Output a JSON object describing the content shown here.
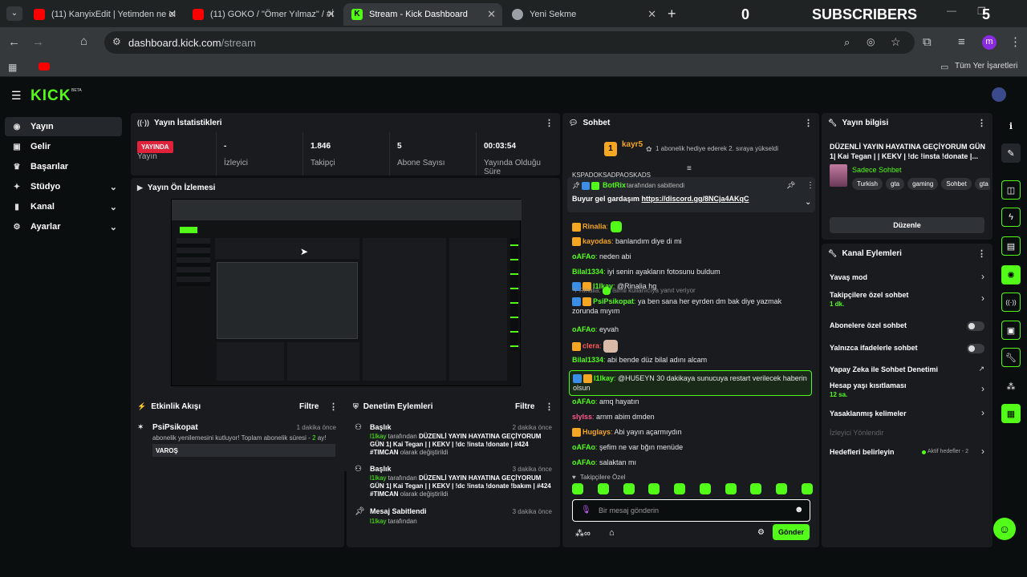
{
  "browser": {
    "tabs": [
      {
        "label": "(11) KanyixEdit | Yetimden ne ol",
        "icon": "youtube-icon",
        "color": "#ff0000"
      },
      {
        "label": "(11) GOKO / \"Ömer Yılmaz\" / #İ",
        "icon": "youtube-icon",
        "color": "#ff0000"
      },
      {
        "label": "Stream - Kick Dashboard",
        "icon": "kick-icon",
        "color": "#53fc18"
      },
      {
        "label": "Yeni Sekme",
        "icon": "chrome-icon",
        "color": "#9aa0a6"
      }
    ],
    "new_tab": "+",
    "overlay": {
      "count": "0",
      "label": "SUBSCRIBERS",
      "goal": "5"
    },
    "url": {
      "domain": "dashboard.kick.com",
      "path": "/stream"
    },
    "profile_initial": "m",
    "bookmarks_label": "Tüm Yer İşaretleri"
  },
  "app": {
    "logo": "KICK",
    "logo_beta": "BETA",
    "sidebar": [
      {
        "label": "Yayın",
        "icon": "broadcast-icon",
        "active": true
      },
      {
        "label": "Gelir",
        "icon": "wallet-icon"
      },
      {
        "label": "Başarılar",
        "icon": "trophy-icon"
      },
      {
        "label": "Stüdyo",
        "icon": "studio-icon",
        "chevron": true
      },
      {
        "label": "Kanal",
        "icon": "channel-icon",
        "chevron": true
      },
      {
        "label": "Ayarlar",
        "icon": "gear-icon",
        "chevron": true
      }
    ],
    "stats": {
      "title": "Yayın İstatistikleri",
      "live_badge": "YAYINDA",
      "items": [
        {
          "value": "",
          "label": "Yayın"
        },
        {
          "value": "-",
          "label": "İzleyici"
        },
        {
          "value": "1.846",
          "label": "Takipçi"
        },
        {
          "value": "5",
          "label": "Abone Sayısı"
        },
        {
          "value": "00:03:54",
          "label": "Yayında Olduğu Süre"
        }
      ]
    },
    "preview": {
      "title": "Yayın Ön İzlemesi"
    },
    "activity": {
      "title": "Etkinlik Akışı",
      "filter": "Filtre",
      "event": {
        "user": "PsiPsikopat",
        "time": "1 dakika önce",
        "text_pre": "abonelik yenilemesini kutluyor! Toplam abonelik süresi - ",
        "months": "2",
        "text_post": " ay!",
        "message": "VAROŞ"
      }
    },
    "moderation": {
      "title": "Denetim Eylemleri",
      "filter": "Filtre",
      "items": [
        {
          "title": "Başlık",
          "time": "2 dakika önce",
          "actor": "l1lkay",
          "by": " tarafından ",
          "content": "DÜZENLİ YAYIN HAYATINA GEÇİYORUM GÜN 1| Kai Tegan | | KEKV | !dc !insta !donate | #424 #TIMCAN",
          "suffix": " olarak değiştirildi"
        },
        {
          "title": "Başlık",
          "time": "3 dakika önce",
          "actor": "l1lkay",
          "by": " tarafından ",
          "content": "DÜZENLİ YAYIN HAYATINA GEÇİYORUM GÜN 1| Kai Tegan | | KEKV | !dc !insta !donate !bakım | #424 #TIMCAN",
          "suffix": " olarak değiştirildi"
        },
        {
          "title": "Mesaj Sabitlendi",
          "time": "3 dakika önce",
          "actor": "l1lkay",
          "by": " tarafından",
          "content": "",
          "suffix": ""
        }
      ]
    },
    "chat": {
      "title": "Sohbet",
      "gift_user": "kayr5",
      "gift_rank": "1",
      "gift_text": "1 abonelik hediye ederek 2. sıraya yükseldi",
      "pinned": {
        "user": "BotRix",
        "by": "tarafından sabitlendi",
        "text": "Buyur gel gardaşım ",
        "link": "https://discord.gg/8NCja4AKqC",
        "peek": "KSPADOKSADPAOSKADS"
      },
      "messages": [
        {
          "user": "Rinalia",
          "color": "#f5a623",
          "text": "",
          "emote": true
        },
        {
          "user": "kayodas",
          "color": "#f5a623",
          "text": "banlandım diye di mi"
        },
        {
          "user": "oAFAo",
          "color": "#53fc18",
          "text": "neden abi"
        },
        {
          "user": "Bilal1334",
          "color": "#53fc18",
          "text": "iyi senin ayakların fotosunu buldum"
        },
        {
          "user": "l1lkay",
          "color": "#53fc18",
          "text": "@Rinalia hg"
        },
        {
          "user": "PsiPsikopat",
          "color": "#53fc18",
          "text": "ya ben sana her eyrden dm bak diye yazmak zorunda mıyım",
          "reply": "Rinalia:",
          "reply_text": "isimli kullanıcıya yanıt veriyor"
        },
        {
          "user": "oAFAo",
          "color": "#53fc18",
          "text": "eyvah"
        },
        {
          "user": "clera",
          "color": "#ff5a5a",
          "text": "",
          "emote": true
        },
        {
          "user": "Bilal1334",
          "color": "#53fc18",
          "text": "abi bende düz bilal adını alcam"
        },
        {
          "user": "l1lkay",
          "color": "#53fc18",
          "text": "@HU5EYN 30 dakikaya sunucuya restart verilecek haberin olsun",
          "highlight": true
        },
        {
          "user": "oAFAo",
          "color": "#53fc18",
          "text": "amq hayatın"
        },
        {
          "user": "slylss",
          "color": "#ff5a8a",
          "text": "arnm abim dmden"
        },
        {
          "user": "Huglays",
          "color": "#f5a623",
          "text": "Abi yayın açarmıydın"
        },
        {
          "user": "oAFAo",
          "color": "#53fc18",
          "text": "şefim ne var bğın menüde"
        },
        {
          "user": "oAFAo",
          "color": "#53fc18",
          "text": "salaktan mı"
        }
      ],
      "followers_label": "Takipçilere Özel",
      "input_placeholder": "Bir mesaj gönderin",
      "send": "Gönder"
    },
    "stream_info": {
      "title": "Yayın bilgisi",
      "stream_title": "DÜZENLİ YAYIN HAYATINA GEÇİYORUM GÜN 1| Kai Tegan | | KEKV | !dc !insta !donate |...",
      "category": "Sadece Sohbet",
      "tags": [
        "Turkish",
        "gta",
        "gaming",
        "Sohbet",
        "gta"
      ],
      "edit": "Düzenle"
    },
    "channel_actions": {
      "title": "Kanal Eylemleri",
      "items": [
        {
          "label": "Yavaş mod",
          "type": "chevron"
        },
        {
          "label": "Takipçilere özel sohbet",
          "sub": "1 dk.",
          "type": "chevron"
        },
        {
          "label": "Abonelere özel sohbet",
          "type": "toggle"
        },
        {
          "label": "Yalnızca ifadelerle sohbet",
          "type": "toggle"
        },
        {
          "label": "Yapay Zeka ile Sohbet Denetimi",
          "type": "external"
        },
        {
          "label": "Hesap yaşı kısıtlaması",
          "sub": "12 sa.",
          "type": "chevron"
        },
        {
          "label": "Yasaklanmış kelimeler",
          "type": "chevron"
        },
        {
          "label": "İzleyici Yönlendir",
          "type": "disabled"
        },
        {
          "label": "Hedefleri belirleyin",
          "type": "chevron",
          "status": "Aktif hedefler - 2"
        }
      ]
    }
  }
}
